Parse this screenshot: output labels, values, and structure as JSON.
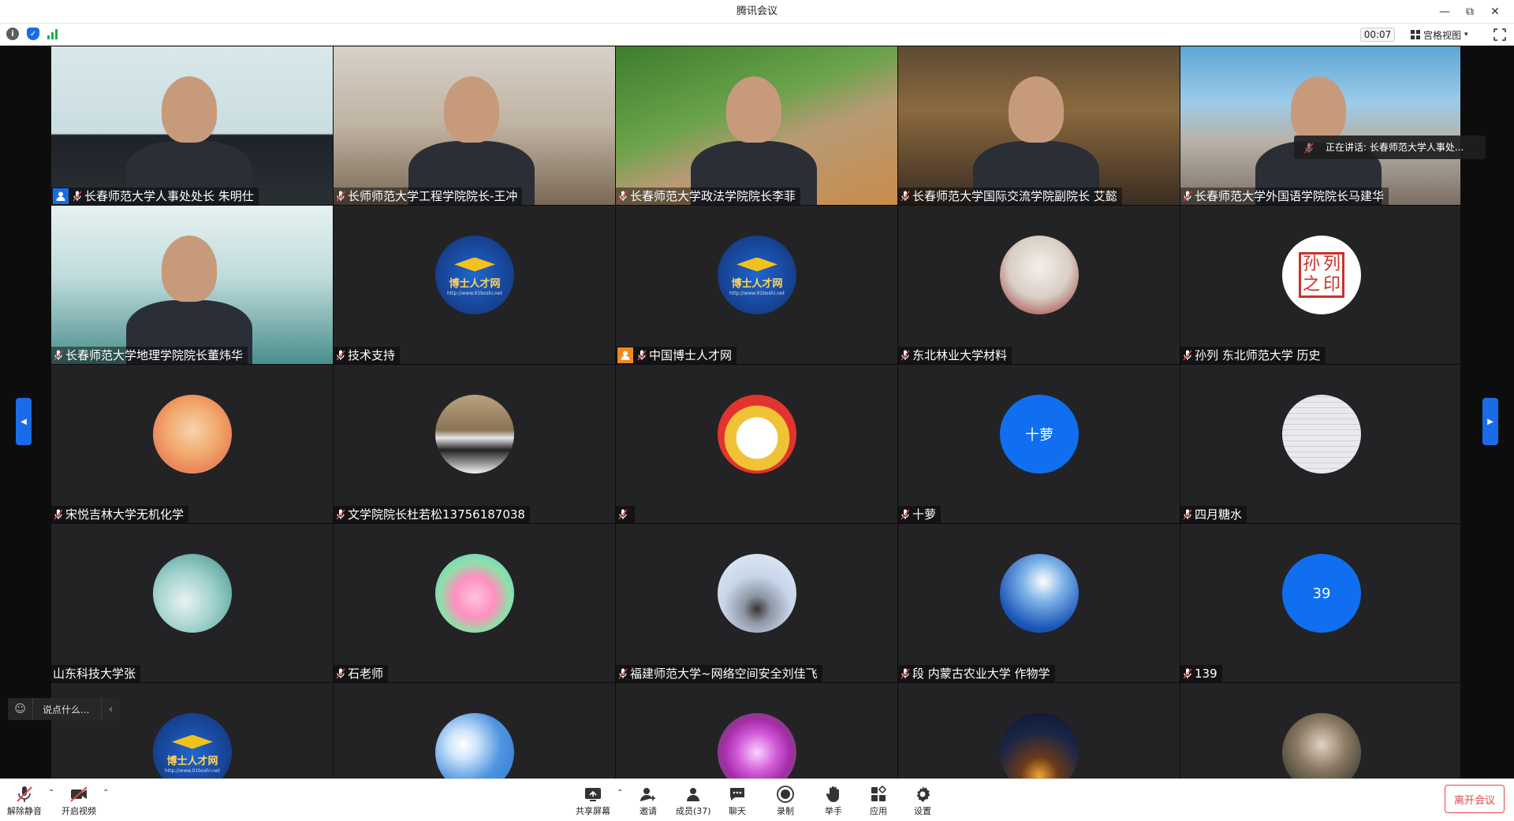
{
  "window": {
    "title": "腾讯会议"
  },
  "infobar": {
    "timer": "00:07",
    "view_label": "宫格视图"
  },
  "speaking": {
    "text": "正在讲话: 长春师范大学人事处..."
  },
  "tiles": [
    {
      "name": "长春师范大学人事处处长 朱明仕",
      "kind": "video",
      "video": "video1",
      "icon": "blue"
    },
    {
      "name": "长师师范大学工程学院院长-王冲",
      "kind": "video",
      "video": "video2"
    },
    {
      "name": "长春师范大学政法学院院长李菲",
      "kind": "video",
      "video": "video3"
    },
    {
      "name": "长春师范大学国际交流学院副院长 艾懿",
      "kind": "video",
      "video": "video4"
    },
    {
      "name": "长春师范大学外国语学院院长马建华",
      "kind": "video",
      "video": "video5"
    },
    {
      "name": "长春师范大学地理学院院长董炜华",
      "kind": "video",
      "video": "video6"
    },
    {
      "name": "技术支持",
      "kind": "avatar",
      "avatar": "av-doctor"
    },
    {
      "name": "中国博士人才网",
      "kind": "avatar",
      "avatar": "av-doctor",
      "icon": "orange"
    },
    {
      "name": "东北林业大学材料",
      "kind": "avatar",
      "avatar": "av-food"
    },
    {
      "name": "孙列 东北师范大学 历史",
      "kind": "avatar",
      "avatar": "av-seal"
    },
    {
      "name": "宋悦吉林大学无机化学",
      "kind": "avatar",
      "avatar": "av-anime"
    },
    {
      "name": "文学院院长杜若松13756187038",
      "kind": "avatar",
      "avatar": "av-piano"
    },
    {
      "name": "",
      "kind": "avatar",
      "avatar": "av-cartoon"
    },
    {
      "name": "十萝",
      "kind": "avatar",
      "avatar": "av-blue",
      "avatar_text": "十萝"
    },
    {
      "name": "四月糖水",
      "kind": "avatar",
      "avatar": "av-girl"
    },
    {
      "name": "山东科技大学张",
      "kind": "avatar",
      "avatar": "av-water",
      "no_mic": true
    },
    {
      "name": "石老师",
      "kind": "avatar",
      "avatar": "av-rabbit"
    },
    {
      "name": "福建师范大学~网络空间安全刘佳飞",
      "kind": "avatar",
      "avatar": "av-blur"
    },
    {
      "name": "段 内蒙古农业大学 作物学",
      "kind": "avatar",
      "avatar": "av-singer"
    },
    {
      "name": "139",
      "kind": "avatar",
      "avatar": "av-blue",
      "avatar_text": "39"
    },
    {
      "name": "",
      "kind": "avatar",
      "avatar": "av-doctor",
      "no_label": true
    },
    {
      "name": "",
      "kind": "avatar",
      "avatar": "av-sky",
      "no_label": true
    },
    {
      "name": "",
      "kind": "avatar",
      "avatar": "av-flower",
      "no_label": true
    },
    {
      "name": "",
      "kind": "avatar",
      "avatar": "av-night",
      "no_label": true
    },
    {
      "name": "",
      "kind": "avatar",
      "avatar": "av-soldier",
      "no_label": true
    }
  ],
  "doctor_logo": {
    "text": "博士人才网",
    "url": "http://www.91boshi.net"
  },
  "seal_chars": [
    "孙",
    "列",
    "之",
    "印"
  ],
  "chat": {
    "placeholder": "说点什么..."
  },
  "toolbar": {
    "unmute": "解除静音",
    "start_video": "开启视频",
    "share": "共享屏幕",
    "invite": "邀请",
    "members": "成员(37)",
    "chat": "聊天",
    "record": "录制",
    "raise_hand": "举手",
    "apps": "应用",
    "settings": "设置",
    "leave": "离开会议"
  },
  "colors": {
    "accent": "#1a6be8",
    "leave": "#e2474a",
    "tile_bg": "#232325",
    "stage_bg": "#0d0d0e"
  }
}
